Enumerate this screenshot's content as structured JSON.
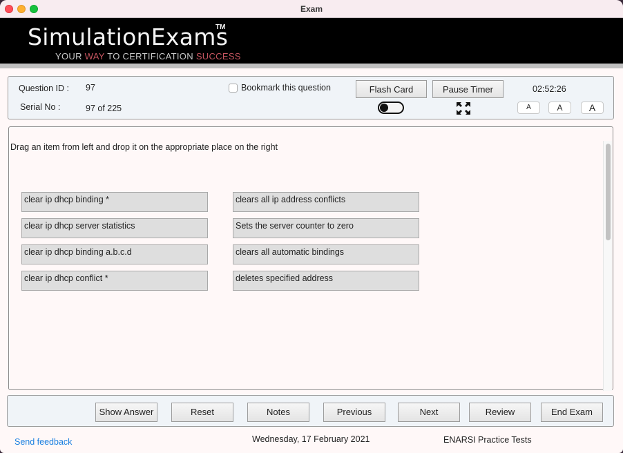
{
  "window": {
    "title": "Exam"
  },
  "banner": {
    "logo": "SimulationExams",
    "trademark": "TM",
    "tagline_part1": "YOUR ",
    "tagline_accent1": "WAY",
    "tagline_part2": " TO CERTIFICATION ",
    "tagline_accent2": "SUCCESS",
    "accent_color": "#c75560"
  },
  "info": {
    "question_id_label": "Question ID :",
    "question_id_value": "97",
    "serial_label": "Serial No :",
    "serial_value": "97 of 225",
    "bookmark_label": "Bookmark this question",
    "bookmark_checked": false,
    "flash_card_label": "Flash Card",
    "pause_timer_label": "Pause Timer",
    "timer": "02:52:26",
    "flash_card_toggle": "off",
    "expand_icon": "fullscreen-expand-icon",
    "font_sizes": [
      "A",
      "A",
      "A"
    ]
  },
  "question": {
    "instruction": "Drag an item from left and drop it on the appropriate place on the right",
    "left_items": [
      "clear ip dhcp binding *",
      "clear ip dhcp server statistics",
      "clear ip dhcp binding a.b.c.d",
      "clear ip dhcp conflict *"
    ],
    "right_items": [
      "clears all ip address conflicts",
      "Sets the server counter to zero",
      "clears all automatic bindings",
      "deletes specified address"
    ]
  },
  "actions": {
    "show_answer": "Show Answer",
    "reset": "Reset",
    "notes": "Notes",
    "previous": "Previous",
    "next": "Next",
    "review": "Review",
    "end_exam": "End Exam"
  },
  "footer": {
    "feedback_link": "Send feedback",
    "date": "Wednesday, 17 February 2021",
    "product": "ENARSI Practice Tests",
    "link_color": "#1a7fe0"
  }
}
